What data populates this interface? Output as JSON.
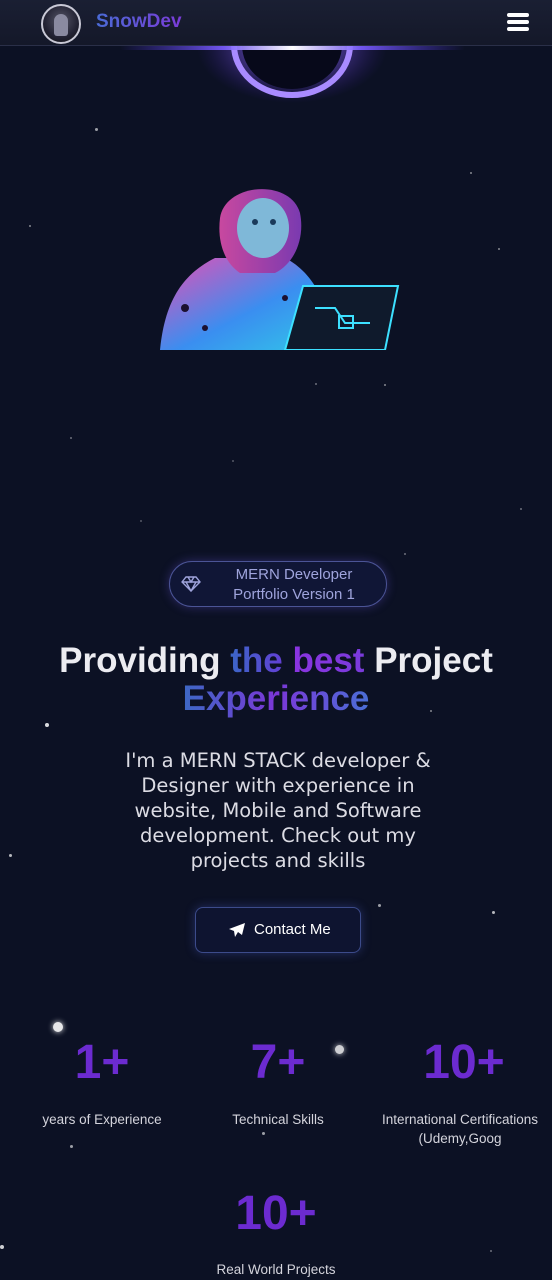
{
  "header": {
    "brand": "SnowDev",
    "menu_icon": "hamburger-menu-icon"
  },
  "hero": {
    "badge_icon": "diamond-icon",
    "badge_line1": "MERN Developer",
    "badge_line2": "Portfolio Version 1",
    "headline_part1": "Providing ",
    "headline_part2": "the ",
    "headline_part3": "best",
    "headline_part4": " Project",
    "headline_part5": "Experience",
    "intro": "I'm a MERN STACK developer & Designer with experience in website, Mobile and Software development. Check out my projects and skills",
    "contact_label": "Contact Me",
    "contact_icon": "paper-plane-icon"
  },
  "stats": [
    {
      "value": "1+",
      "label": "years of Experience"
    },
    {
      "value": "7+",
      "label": "Technical Skills"
    },
    {
      "value": "10+",
      "label": "International Certifications(Udemy,Goog"
    },
    {
      "value": "10+",
      "label": "Real World Projects"
    }
  ],
  "colors": {
    "background": "#0c1124",
    "accent_purple": "#6c2bd0",
    "accent_blue": "#3b66c8"
  }
}
